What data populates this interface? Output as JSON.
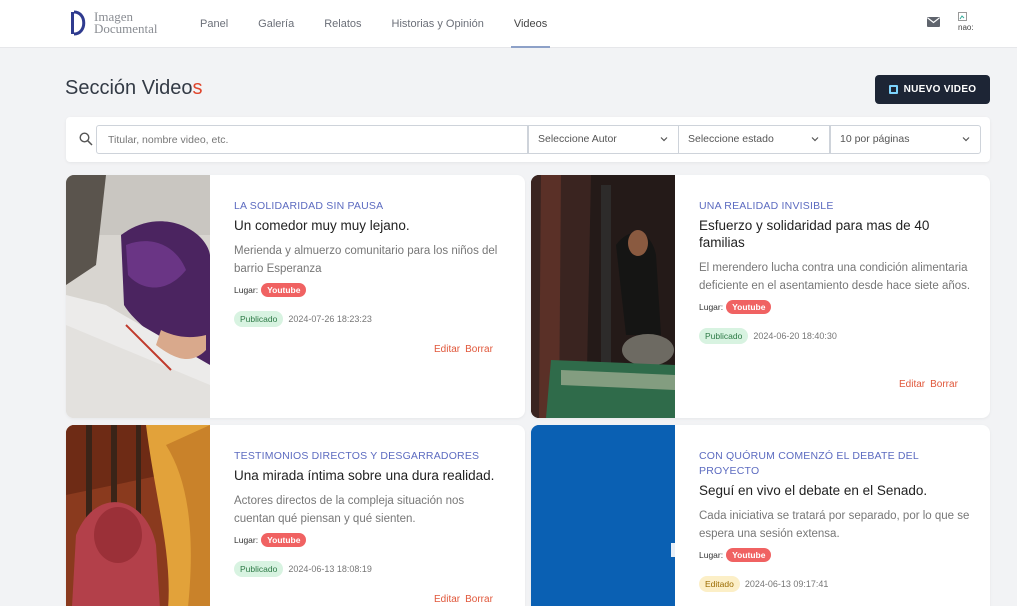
{
  "brand": {
    "line1": "Imagen",
    "line2": "Documental"
  },
  "nav": {
    "items": [
      {
        "label": "Panel"
      },
      {
        "label": "Galería"
      },
      {
        "label": "Relatos"
      },
      {
        "label": "Historias y Opinión"
      },
      {
        "label": "Videos",
        "active": true
      }
    ]
  },
  "header": {
    "avatar_alt": "nao:"
  },
  "page": {
    "title_main": "Sección Video",
    "title_accent": "s",
    "new_button": "NUEVO VIDEO"
  },
  "filters": {
    "search_placeholder": "Titular, nombre video, etc.",
    "author_select": "Seleccione Autor",
    "status_select": "Seleccione estado",
    "per_page_select": "10 por páginas"
  },
  "labels": {
    "place": "Lugar:",
    "edit": "Editar",
    "delete": "Borrar"
  },
  "cards": [
    {
      "kicker": "LA SOLIDARIDAD SIN PAUSA",
      "title": "Un comedor muy muy lejano.",
      "summary": "Merienda y almuerzo comunitario para los niños del barrio Esperanza",
      "place": "Youtube",
      "status": "Publicado",
      "date": "2024-07-26 18:23:23"
    },
    {
      "kicker": "UNA REALIDAD INVISIBLE",
      "title": "Esfuerzo y solidaridad para mas de 40 familias",
      "summary": "El merendero lucha contra una condición alimentaria deficiente en el asentamiento desde hace siete años.",
      "place": "Youtube",
      "status": "Publicado",
      "date": "2024-06-20 18:40:30"
    },
    {
      "kicker": "TESTIMONIOS DIRECTOS Y DESGARRADORES",
      "title": "Una mirada íntima sobre una dura realidad.",
      "summary": "Actores directos de la compleja situación nos cuentan qué piensan y qué sienten.",
      "place": "Youtube",
      "status": "Publicado",
      "date": "2024-06-13 18:08:19"
    },
    {
      "kicker": "CON QUÓRUM COMENZÓ EL DEBATE DEL PROYECTO",
      "title": "Seguí en vivo el debate en el Senado.",
      "summary": "Cada iniciativa se tratará por separado, por lo que se espera una sesión extensa.",
      "place": "Youtube",
      "status": "Editado",
      "date": "2024-06-13 09:17:41"
    }
  ],
  "colors": {
    "accent": "#e0452c",
    "kicker": "#5c6bc0",
    "button_bg": "#1d2535",
    "badge_red": "#f06262"
  }
}
